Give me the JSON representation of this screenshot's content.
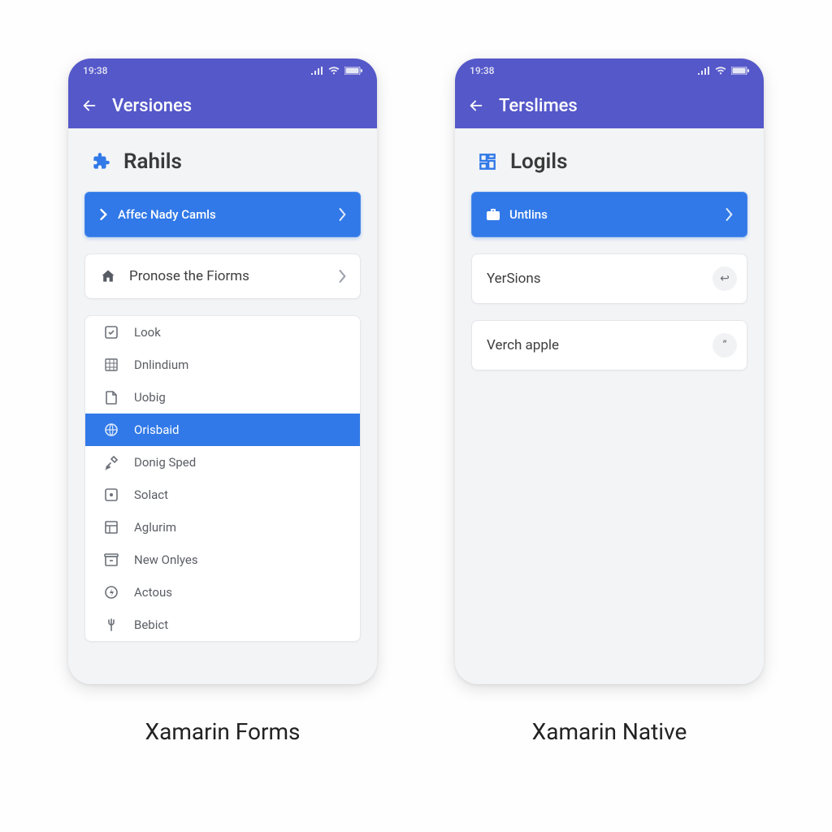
{
  "phones": {
    "left": {
      "status_time": "19:38",
      "nav_title": "Versiones",
      "section_title": "Rahils",
      "primary_button_label": "Affec Nady Camls",
      "secondary_row_label": "Pronose the Fiorms",
      "list": [
        {
          "label": "Look",
          "icon": "doc-check-icon"
        },
        {
          "label": "Dnlindium",
          "icon": "grid-icon"
        },
        {
          "label": "Uobig",
          "icon": "file-icon"
        },
        {
          "label": "Orisbaid",
          "icon": "globe-icon",
          "selected": true
        },
        {
          "label": "Donig Sped",
          "icon": "tools-icon"
        },
        {
          "label": "Solact",
          "icon": "square-dot-icon"
        },
        {
          "label": "Aglurim",
          "icon": "layout-icon"
        },
        {
          "label": "New Onlyes",
          "icon": "archive-icon"
        },
        {
          "label": "Actous",
          "icon": "bolt-circle-icon"
        },
        {
          "label": "Bebict",
          "icon": "fork-icon"
        }
      ],
      "caption": "Xamarin Forms"
    },
    "right": {
      "status_time": "19:38",
      "nav_title": "Terslimes",
      "section_title": "Logils",
      "primary_button_label": "Untlins",
      "rows": [
        {
          "label": "YerSions",
          "badge": "↩"
        },
        {
          "label": "Verch apple",
          "badge": "”"
        }
      ],
      "caption": "Xamarin Native"
    }
  },
  "colors": {
    "accent": "#5558c9",
    "primary_btn": "#3179e8",
    "bg": "#f3f4f6"
  }
}
